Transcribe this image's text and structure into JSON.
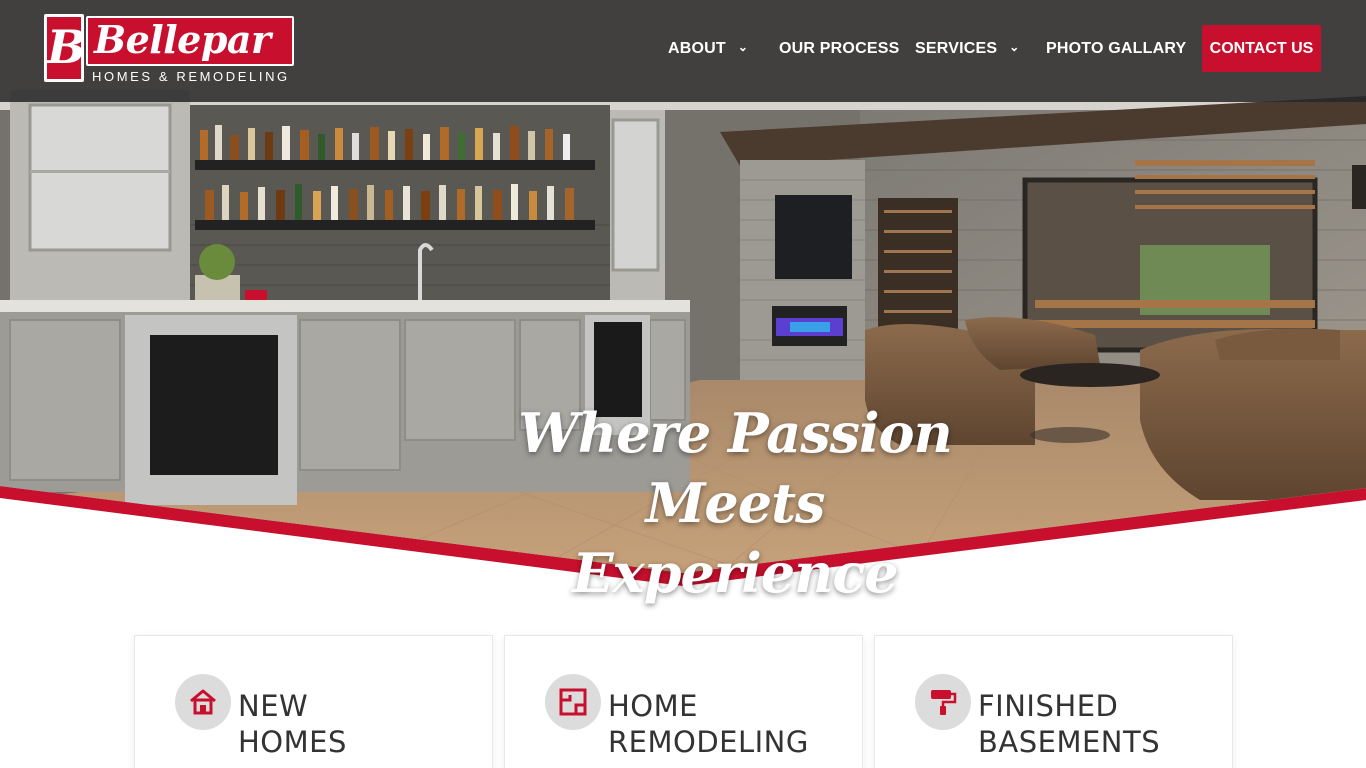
{
  "brand": {
    "logo_letter": "B",
    "logo_name": "Bellepar",
    "logo_tagline": "HOMES & REMODELING",
    "accent_color": "#c8102e",
    "header_bg": "#2b2b2b"
  },
  "nav": {
    "items": [
      {
        "label": "ABOUT",
        "has_dropdown": true,
        "icon": "chevron-down-icon"
      },
      {
        "label": "OUR PROCESS",
        "has_dropdown": false
      },
      {
        "label": "SERVICES",
        "has_dropdown": true,
        "icon": "chevron-down-icon"
      },
      {
        "label": "PHOTO GALLARY",
        "has_dropdown": false
      }
    ],
    "contact_label": "CONTACT US"
  },
  "hero": {
    "line1": "Where Passion",
    "line2": "Meets Experience",
    "image_subject": "finished basement with wet bar, wine cellar and lounge chairs"
  },
  "services": [
    {
      "line1": "NEW",
      "line2": "HOMES",
      "icon": "house-icon"
    },
    {
      "line1": "HOME",
      "line2": "REMODELING",
      "icon": "floor-plan-icon"
    },
    {
      "line1": "FINISHED",
      "line2": "BASEMENTS",
      "icon": "paint-roller-icon"
    }
  ]
}
